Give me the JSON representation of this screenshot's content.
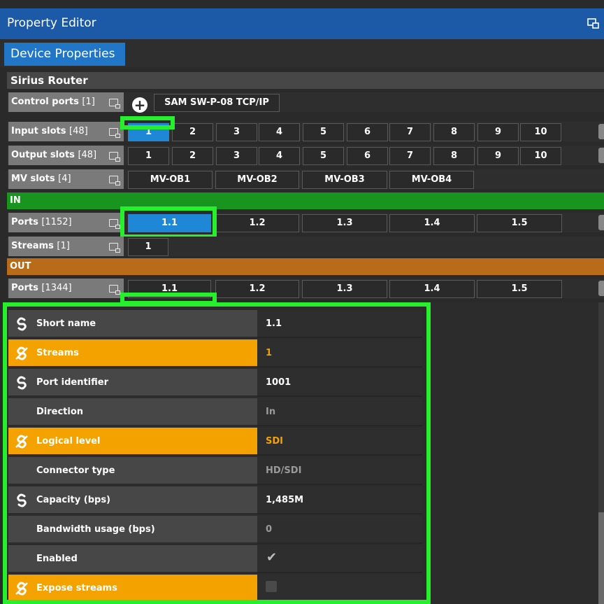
{
  "panel": {
    "title": "Property Editor"
  },
  "tabs": {
    "active": "Device Properties"
  },
  "router": {
    "name": "Sirius Router"
  },
  "control_ports": {
    "label": "Control ports",
    "count": "[1]",
    "add_symbol": "+",
    "value": "SAM SW-P-08 TCP/IP"
  },
  "input_slots": {
    "label": "Input slots",
    "count": "[48]",
    "cells": [
      "1",
      "2",
      "3",
      "4",
      "5",
      "6",
      "7",
      "8",
      "9",
      "10"
    ],
    "selected": "1"
  },
  "output_slots": {
    "label": "Output slots",
    "count": "[48]",
    "cells": [
      "1",
      "2",
      "3",
      "4",
      "5",
      "6",
      "7",
      "8",
      "9",
      "10"
    ]
  },
  "mv_slots": {
    "label": "MV slots",
    "count": "[4]",
    "cells": [
      "MV-OB1",
      "MV-OB2",
      "MV-OB3",
      "MV-OB4"
    ]
  },
  "in_section": {
    "title": "IN",
    "ports": {
      "label": "Ports",
      "count": "[1152]",
      "cells": [
        "1.1",
        "1.2",
        "1.3",
        "1.4",
        "1.5"
      ],
      "selected": "1.1"
    },
    "streams": {
      "label": "Streams",
      "count": "[1]",
      "cells": [
        "1"
      ]
    }
  },
  "out_section": {
    "title": "OUT",
    "ports": {
      "label": "Ports",
      "count": "[1344]",
      "cells": [
        "1.1",
        "1.2",
        "1.3",
        "1.4",
        "1.5"
      ]
    }
  },
  "properties": [
    {
      "name": "Short name",
      "value": "1.1",
      "link": "linked",
      "style": "normal"
    },
    {
      "name": "Streams",
      "value": "1",
      "link": "unlinked",
      "style": "orange"
    },
    {
      "name": "Port identifier",
      "value": "1001",
      "link": "linked",
      "style": "normal"
    },
    {
      "name": "Direction",
      "value": "In",
      "link": "none",
      "style": "dim"
    },
    {
      "name": "Logical level",
      "value": "SDI",
      "link": "unlinked",
      "style": "orange"
    },
    {
      "name": "Connector type",
      "value": "HD/SDI",
      "link": "none",
      "style": "dim"
    },
    {
      "name": "Capacity (bps)",
      "value": "1,485M",
      "link": "linked",
      "style": "normal"
    },
    {
      "name": "Bandwidth usage (bps)",
      "value": "0",
      "link": "none",
      "style": "dim"
    },
    {
      "name": "Enabled",
      "value": "",
      "checkbox": "checked",
      "link": "none",
      "style": "normal"
    },
    {
      "name": "Expose streams",
      "value": "",
      "checkbox": "unchecked",
      "link": "unlinked",
      "style": "orange"
    }
  ],
  "colors": {
    "selected": "#1e88d6",
    "highlight": "#25f02b",
    "in": "#17951e",
    "out": "#b96c18",
    "override": "#f3a200",
    "title_bar": "#1c5aa8"
  },
  "icons": {
    "dock": "undock-window-icon",
    "linked": "link-icon",
    "unlinked": "unlink-icon"
  }
}
